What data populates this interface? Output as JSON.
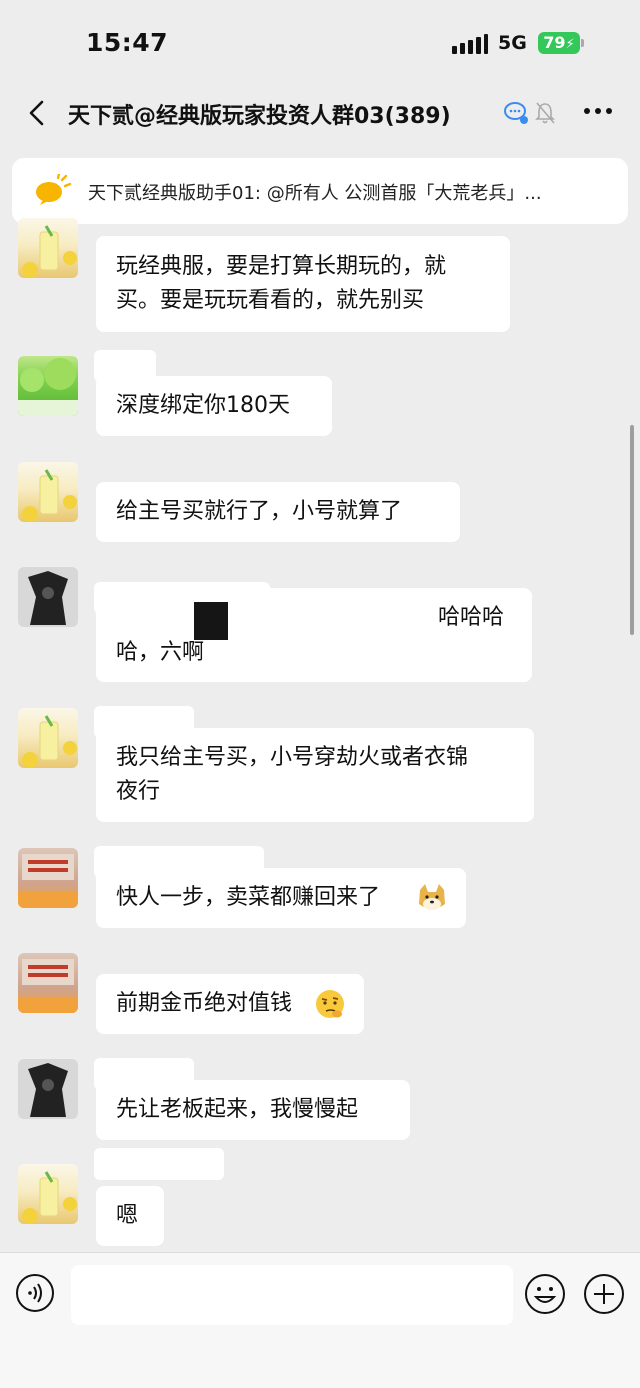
{
  "status_bar": {
    "time": "15:47",
    "network": "5G",
    "battery": "79"
  },
  "header": {
    "title": "天下贰@经典版玩家投资人群03(389)"
  },
  "notice": {
    "text": "天下贰经典版助手01: @所有人  公测首服「大荒老兵」..."
  },
  "messages": [
    {
      "avatar": "lemon-drink-avatar",
      "lines": [
        "玩经典服，要是打算长期玩的，就",
        "买。要是玩玩看看的，就先别买"
      ]
    },
    {
      "avatar": "forest-avatar",
      "lines": [
        "深度绑定你180天"
      ]
    },
    {
      "avatar": "lemon-drink-avatar",
      "lines": [
        "给主号买就行了，小号就算了"
      ]
    },
    {
      "avatar": "dark-figure-avatar",
      "lines": [
        "哈哈哈",
        "哈，六啊"
      ]
    },
    {
      "avatar": "lemon-drink-avatar",
      "lines": [
        "我只给主号买，小号穿劫火或者衣锦",
        "夜行"
      ]
    },
    {
      "avatar": "shop-sign-avatar",
      "lines": [
        "快人一步，卖菜都赚回来了"
      ],
      "emoji": "doge-emoji"
    },
    {
      "avatar": "shop-sign-avatar",
      "lines": [
        "前期金币绝对值钱"
      ],
      "emoji": "thinking-emoji"
    },
    {
      "avatar": "dark-figure-avatar",
      "lines": [
        "先让老板起来，我慢慢起"
      ]
    },
    {
      "avatar": "lemon-drink-avatar",
      "lines": [
        "嗯"
      ]
    }
  ],
  "colors": {
    "background": "#ededed",
    "bubble": "#ffffff",
    "battery": "#34c759",
    "notice_icon": "#f7b500"
  }
}
